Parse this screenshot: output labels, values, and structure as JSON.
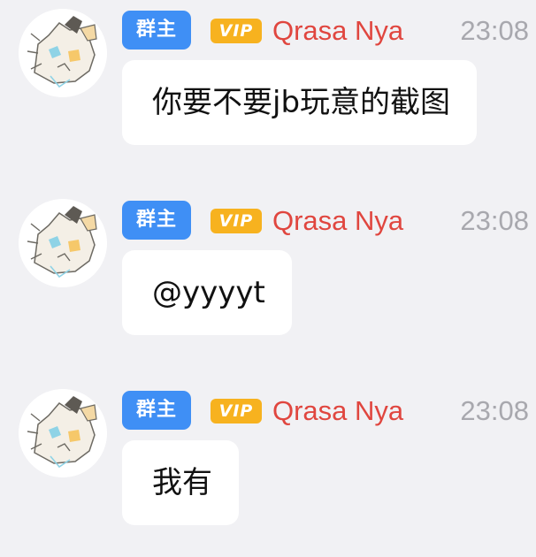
{
  "messages": [
    {
      "role_badge": "群主",
      "vip_badge": "VIP",
      "nickname": "Qrasa Nya",
      "time": "23:08",
      "text": "你要不要jb玩意的截图"
    },
    {
      "role_badge": "群主",
      "vip_badge": "VIP",
      "nickname": "Qrasa Nya",
      "time": "23:08",
      "text": "@yyyyt"
    },
    {
      "role_badge": "群主",
      "vip_badge": "VIP",
      "nickname": "Qrasa Nya",
      "time": "23:08",
      "text": "我有"
    }
  ],
  "colors": {
    "background": "#f1f1f4",
    "role_badge": "#3f8ff5",
    "vip_badge": "#f7b21f",
    "nickname": "#e0463f",
    "time": "#a8a8ae",
    "bubble": "#ffffff"
  },
  "icons": {
    "avatar": "avatar-icon"
  }
}
